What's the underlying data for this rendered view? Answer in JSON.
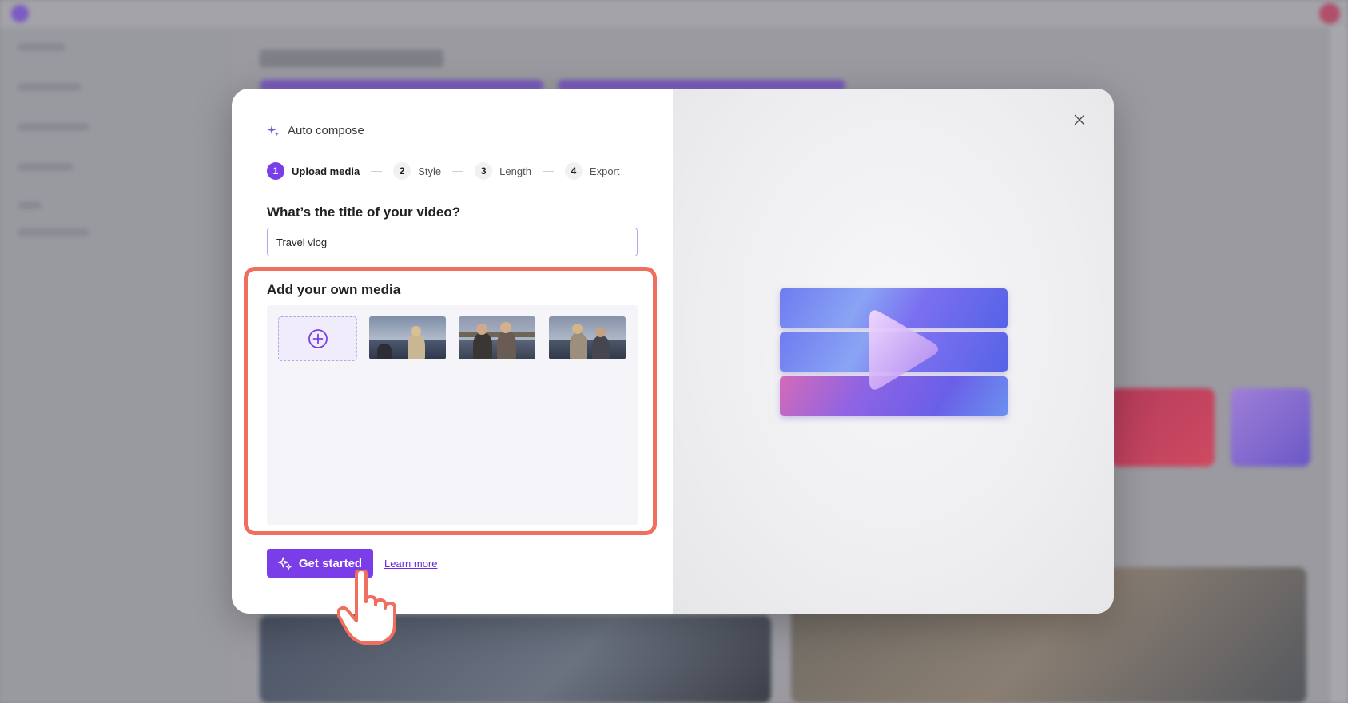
{
  "modal": {
    "header_title": "Auto compose",
    "steps": [
      {
        "number": "1",
        "label": "Upload media",
        "active": true
      },
      {
        "number": "2",
        "label": "Style",
        "active": false
      },
      {
        "number": "3",
        "label": "Length",
        "active": false
      },
      {
        "number": "4",
        "label": "Export",
        "active": false
      }
    ],
    "title_question": "What’s the title of your video?",
    "title_value": "Travel vlog",
    "media_heading": "Add your own media",
    "media_items": [
      "add-media-icon",
      "travel-clip-1",
      "travel-clip-2",
      "travel-clip-3"
    ],
    "cta_label": "Get started",
    "learn_more_label": "Learn more",
    "close_icon": "close-icon"
  },
  "colors": {
    "accent": "#7a3ee8",
    "highlight": "#f06e5e",
    "link": "#6a2bd9"
  }
}
